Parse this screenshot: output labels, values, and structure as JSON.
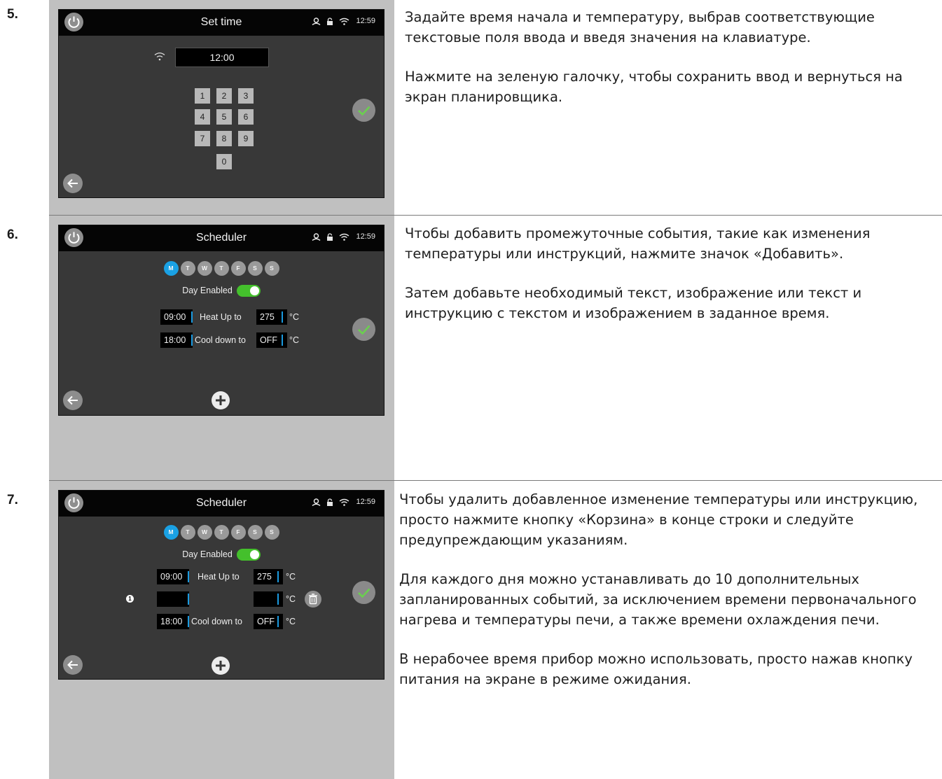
{
  "step5": {
    "number": "5.",
    "screen": {
      "title": "Set time",
      "clock": "12:59",
      "time_value": "12:00",
      "keys": [
        "1",
        "2",
        "3",
        "4",
        "5",
        "6",
        "7",
        "8",
        "9",
        "0"
      ]
    },
    "paragraphs": [
      "Задайте время начала и температуру, выбрав соответствующие текстовые поля ввода и введя значения на клавиатуре.",
      "Нажмите на зеленую галочку, чтобы сохранить ввод и вернуться на экран планировщика."
    ]
  },
  "step6": {
    "number": "6.",
    "screen": {
      "title": "Scheduler",
      "clock": "12:59",
      "days": [
        "M",
        "T",
        "W",
        "T",
        "F",
        "S",
        "S"
      ],
      "day_enabled": "Day Enabled",
      "rows": [
        {
          "time": "09:00",
          "label": "Heat Up to",
          "temp": "275",
          "unit": "°C"
        },
        {
          "time": "18:00",
          "label": "Cool down to",
          "temp": "OFF",
          "unit": "°C"
        }
      ]
    },
    "paragraphs": [
      "Чтобы добавить промежуточные события, такие как изменения температуры или инструкций, нажмите значок «Добавить».",
      "Затем добавьте необходимый текст, изображение или текст и инструкцию с текстом и изображением в заданное время."
    ]
  },
  "step7": {
    "number": "7.",
    "screen": {
      "title": "Scheduler",
      "clock": "12:59",
      "days": [
        "M",
        "T",
        "W",
        "T",
        "F",
        "S",
        "S"
      ],
      "day_enabled": "Day Enabled",
      "rows": [
        {
          "time": "09:00",
          "label": "Heat Up to",
          "temp": "275",
          "unit": "°C"
        },
        {
          "time": "",
          "label": "",
          "temp": "",
          "unit": "°C"
        },
        {
          "time": "18:00",
          "label": "Cool down to",
          "temp": "OFF",
          "unit": "°C"
        }
      ],
      "marker": "1"
    },
    "paragraphs": [
      "Чтобы удалить добавленное изменение температуры или инструкцию, просто нажмите кнопку «Корзина» в конце строки и следуйте предупреждающим указаниям.",
      "Для каждого дня можно устанавливать до 10 дополнительных запланированных событий, за исключением времени первоначального нагрева и температуры печи, а также времени охлаждения печи.",
      "В нерабочее время прибор можно использовать, просто нажав кнопку питания на экране в режиме ожидания."
    ]
  },
  "colors": {
    "accent_blue": "#1aa1e4",
    "toggle_green": "#44c02c",
    "check_green": "#6ad04e"
  }
}
